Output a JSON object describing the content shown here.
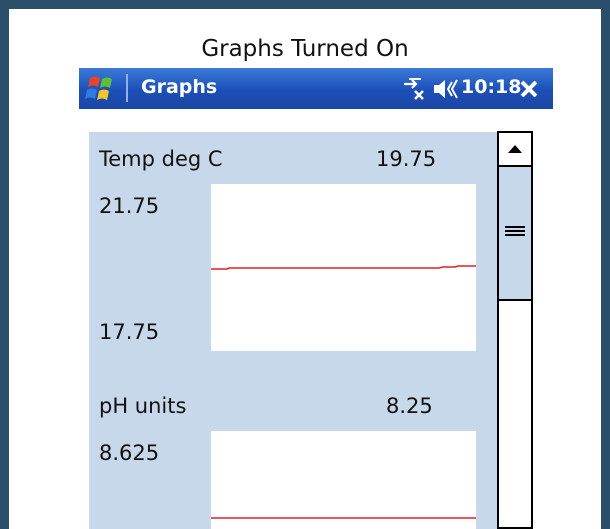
{
  "caption": "Graphs Turned On",
  "titlebar": {
    "app_title": "Graphs",
    "time": "10:18",
    "icons": [
      "windows-start-icon",
      "network-disconnected-icon",
      "speaker-icon",
      "close-icon"
    ]
  },
  "graphs": [
    {
      "label": "Temp deg C",
      "current": "19.75",
      "max_label": "21.75",
      "min_label": "17.75",
      "line_color": "#e02020"
    },
    {
      "label": "pH units",
      "current": "8.25",
      "max_label": "8.625",
      "min_label": "",
      "line_color": "#e02020"
    }
  ],
  "scrollbar": {
    "up_icon": "scroll-up-arrow-icon",
    "thumb_icon": "grip-icon"
  }
}
